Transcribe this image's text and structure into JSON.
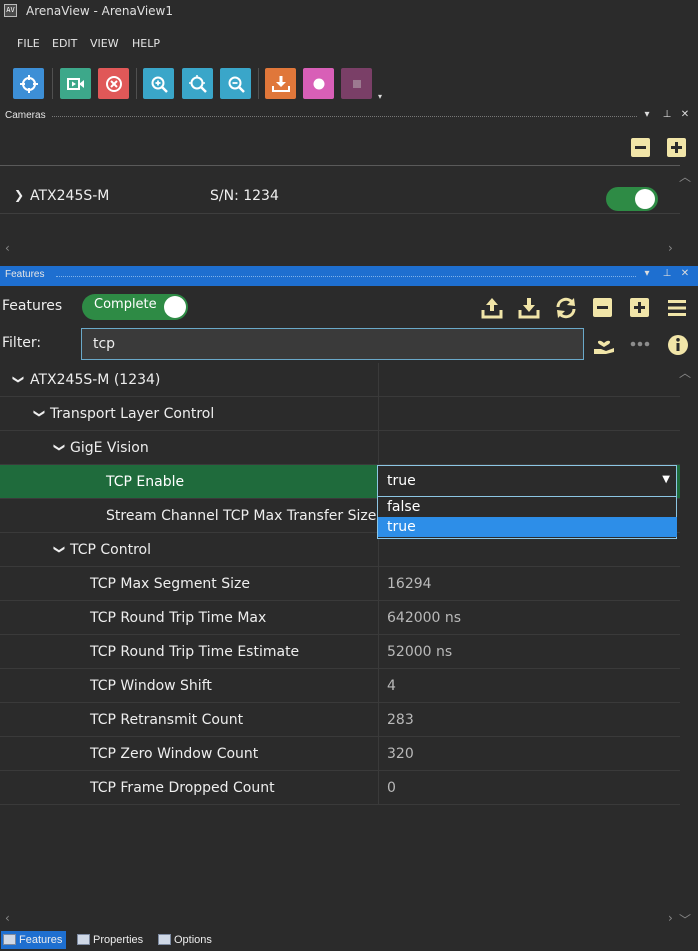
{
  "window": {
    "title": "ArenaView - ArenaView1",
    "icon": "app-icon"
  },
  "menu": [
    "FILE",
    "EDIT",
    "VIEW",
    "HELP"
  ],
  "toolbar": {
    "buttons": [
      {
        "name": "select-device-icon",
        "color": "#3d8fd6"
      },
      {
        "name": "start-stream-icon",
        "color": "#3da88a"
      },
      {
        "name": "stop-stream-icon",
        "color": "#e05858"
      },
      {
        "name": "zoom-in-icon",
        "color": "#3aa6c9"
      },
      {
        "name": "zoom-fit-icon",
        "color": "#3aa6c9"
      },
      {
        "name": "zoom-out-icon",
        "color": "#3aa6c9"
      },
      {
        "name": "save-image-icon",
        "color": "#e0773a"
      },
      {
        "name": "record-icon",
        "color": "#d85fb7"
      },
      {
        "name": "stop-record-icon",
        "color": "#7a3f67"
      }
    ],
    "overflow": "▾"
  },
  "cameras_panel": {
    "title": "Cameras",
    "camera": {
      "name": "ATX245S-M",
      "serial": "S/N: 1234",
      "enabled": true
    }
  },
  "features_panel": {
    "title": "Features",
    "label": "Features",
    "mode_toggle": "Complete",
    "filter_label": "Filter:",
    "filter_value": "tcp",
    "tree": [
      {
        "label": "ATX245S-M (1234)",
        "level": 0,
        "expandable": true,
        "value": ""
      },
      {
        "label": "Transport Layer Control",
        "level": 1,
        "expandable": true,
        "value": ""
      },
      {
        "label": "GigE Vision",
        "level": 2,
        "expandable": true,
        "value": ""
      },
      {
        "label": "TCP Enable",
        "level": 3,
        "expandable": false,
        "value": "true",
        "selected": true
      },
      {
        "label": "Stream Channel TCP Max Transfer Size",
        "level": 3,
        "expandable": false,
        "value": ""
      },
      {
        "label": "TCP Control",
        "level": 2,
        "expandable": true,
        "value": ""
      },
      {
        "label": "TCP Max Segment Size",
        "level": 3,
        "expandable": false,
        "value": "16294"
      },
      {
        "label": "TCP Round Trip Time Max",
        "level": 3,
        "expandable": false,
        "value": "642000 ns"
      },
      {
        "label": "TCP Round Trip Time Estimate",
        "level": 3,
        "expandable": false,
        "value": "52000 ns"
      },
      {
        "label": "TCP Window Shift",
        "level": 3,
        "expandable": false,
        "value": "4"
      },
      {
        "label": "TCP Retransmit Count",
        "level": 3,
        "expandable": false,
        "value": "283"
      },
      {
        "label": "TCP Zero Window Count",
        "level": 3,
        "expandable": false,
        "value": "320"
      },
      {
        "label": "TCP Frame Dropped Count",
        "level": 3,
        "expandable": false,
        "value": "0"
      }
    ],
    "dropdown": {
      "value": "true",
      "options": [
        {
          "label": "false",
          "selected": false
        },
        {
          "label": "true",
          "selected": true
        }
      ]
    }
  },
  "bottom_tabs": [
    {
      "label": "Features",
      "active": true
    },
    {
      "label": "Properties",
      "active": false
    },
    {
      "label": "Options",
      "active": false
    }
  ],
  "colors": {
    "selected_row": "#1f6b3c",
    "toggle_on": "#2e8b45",
    "active_header": "#1e6fd0",
    "dropdown_highlight": "#2d8ee8",
    "icon_accent": "#f1e5a8"
  }
}
